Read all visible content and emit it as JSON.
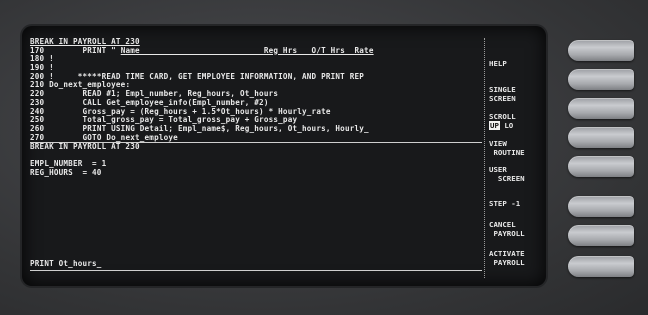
{
  "screen": {
    "header": "BREAK IN PAYROLL AT 230",
    "code_lines": [
      {
        "num": "170",
        "text": "        PRINT \" ",
        "hdr": "Name                          Reg Hrs   O/T Hrs  Rate"
      },
      {
        "num": "180",
        "text": " !",
        "hdr": ""
      },
      {
        "num": "190",
        "text": " !",
        "hdr": ""
      },
      {
        "num": "200",
        "text": " !     *****READ TIME CARD, GET EMPLOYEE INFORMATION, AND PRINT REP",
        "hdr": ""
      },
      {
        "num": "210",
        "text": " Do_next_employee:",
        "hdr": ""
      },
      {
        "num": "220",
        "text": "        READ #1; Empl_number, Reg_hours, Ot_hours",
        "hdr": ""
      },
      {
        "num": "230",
        "text": "        CALL Get_employee_info(Empl_number, #2)",
        "hdr": ""
      },
      {
        "num": "240",
        "text": "        Gross_pay = (Reg_hours + 1.5*Ot_hours) * Hourly_rate",
        "hdr": ""
      },
      {
        "num": "250",
        "text": "        Total_gross_pay = Total_gross_pay + Gross_pay",
        "hdr": ""
      },
      {
        "num": "260",
        "text": "        PRINT USING Detail; Empl_name$, Reg_hours, Ot_hours, Hourly_",
        "hdr": ""
      },
      {
        "num": "270",
        "text": "        GOTO Do_next_employe",
        "hdr": ""
      }
    ],
    "break_line": "BREAK IN PAYROLL AT 230",
    "watch": [
      "EMPL_NUMBER  = 1",
      "REG_HOURS  = 40"
    ],
    "command": "PRINT Ot_hours_"
  },
  "softkeys": [
    {
      "line1": "HELP",
      "line2": ""
    },
    {
      "line1": "SINGLE",
      "line2": "SCREEN"
    },
    {
      "line1": "SCROLL",
      "line2_hi": "UP",
      "line2": " LO"
    },
    {
      "line1": "VIEW",
      "line2": " ROUTINE"
    },
    {
      "line1": "USER",
      "line2": "  SCREEN"
    },
    {
      "line1": "STEP -1",
      "line2": ""
    },
    {
      "line1": "CANCEL",
      "line2": " PAYROLL"
    },
    {
      "line1": "ACTIVATE",
      "line2": " PAYROLL"
    }
  ]
}
